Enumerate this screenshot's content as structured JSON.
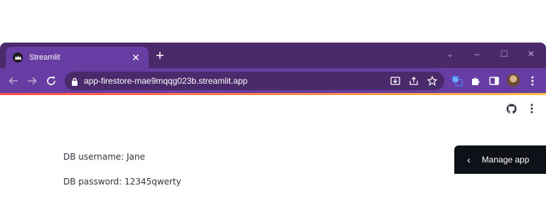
{
  "browser": {
    "tab": {
      "title": "Streamlit",
      "favicon_icon": "streamlit-crown-icon",
      "close_icon": "close-icon",
      "close_glyph": "✕"
    },
    "new_tab_glyph": "+",
    "window_controls": {
      "minimize_glyph": "–",
      "maximize_glyph": "☐",
      "close_glyph": "✕",
      "dropdown_glyph": "⌄"
    },
    "toolbar": {
      "url": "app-firestore-mae9mqqg023b.streamlit.app",
      "icons": [
        "back-icon",
        "forward-icon",
        "reload-icon",
        "lock-icon",
        "install-app-icon",
        "share-icon",
        "bookmark-star-icon",
        "translate-icon",
        "extensions-puzzle-icon",
        "side-panel-icon",
        "profile-avatar",
        "more-menu-icon"
      ]
    },
    "colors": {
      "tabstrip": "#4a2a6b",
      "toolbar": "#673da3",
      "omnibox": "#4a2a6b",
      "accent_start": "#ff4b4b",
      "accent_end": "#ffbd45"
    }
  },
  "app": {
    "header_icons": [
      "github-icon",
      "more-menu-icon"
    ],
    "db_username_line": "DB username: Jane",
    "db_password_line": "DB password: 12345qwerty",
    "manage_app": {
      "label": "Manage app",
      "chevron_glyph": "‹"
    },
    "text_color": "#31333f",
    "manage_bg": "#0e1117"
  }
}
